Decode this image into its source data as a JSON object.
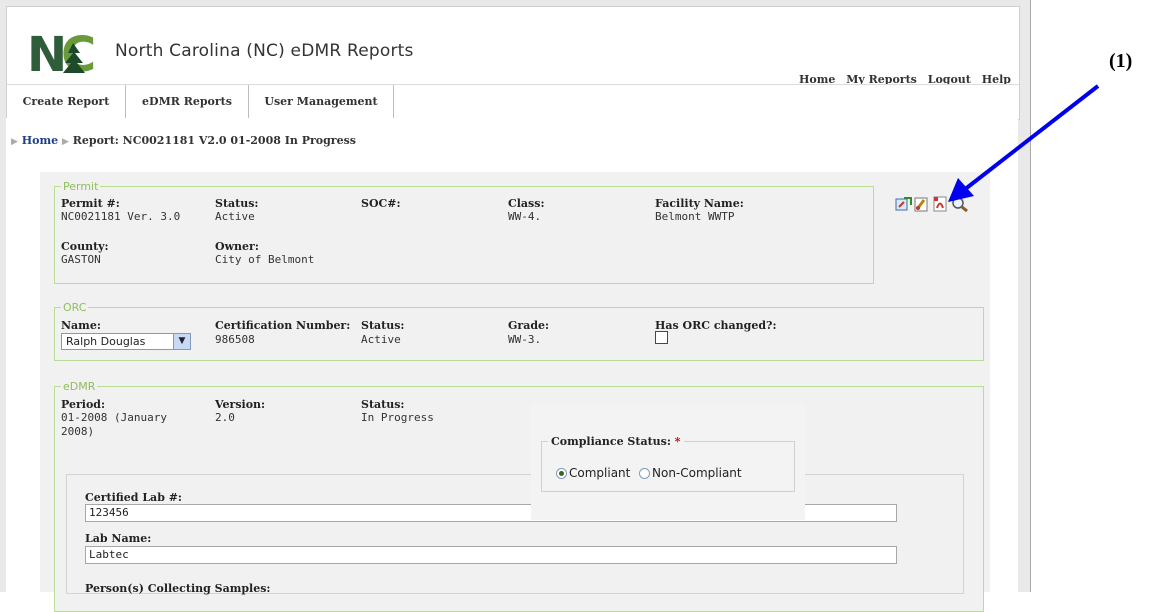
{
  "header": {
    "logo_text": "NC",
    "title": "North Carolina (NC) eDMR Reports",
    "toplinks": [
      "Home",
      "My Reports",
      "Logout",
      "Help"
    ]
  },
  "nav": {
    "tabs": [
      "Create Report",
      "eDMR Reports",
      "User Management"
    ]
  },
  "breadcrumb": {
    "home": "Home",
    "current": "Report: NC0021181 V2.0 01-2008 In Progress"
  },
  "permit": {
    "legend": "Permit",
    "permit_label": "Permit #:",
    "permit_value": "NC0021181 Ver. 3.0",
    "status_label": "Status:",
    "status_value": "Active",
    "soc_label": "SOC#:",
    "class_label": "Class:",
    "class_value": "WW-4.",
    "facility_label": "Facility Name:",
    "facility_value": "Belmont WWTP",
    "county_label": "County:",
    "county_value": "GASTON",
    "owner_label": "Owner:",
    "owner_value": "City of Belmont"
  },
  "orc": {
    "legend": "ORC",
    "name_label": "Name:",
    "name_selected": "Ralph Douglas",
    "cert_label": "Certification Number:",
    "cert_value": "986508",
    "status_label": "Status:",
    "status_value": "Active",
    "grade_label": "Grade:",
    "grade_value": "WW-3.",
    "changed_label": "Has ORC changed?:"
  },
  "edmr": {
    "legend": "eDMR",
    "period_label": "Period:",
    "period_value_1": "01-2008 (January",
    "period_value_2": "2008)",
    "version_label": "Version:",
    "version_value": "2.0",
    "status_label": "Status:",
    "status_value": "In Progress",
    "lab_label": "Certified Lab #:",
    "lab_value": "123456",
    "labname_label": "Lab Name:",
    "labname_value": "Labtec",
    "collectors_label": "Person(s) Collecting Samples:"
  },
  "compliance": {
    "legend": "Compliance Status:",
    "required_mark": "*",
    "option_compliant": "Compliant",
    "option_noncompliant": "Non-Compliant"
  },
  "annotation": {
    "label": "(1)"
  }
}
